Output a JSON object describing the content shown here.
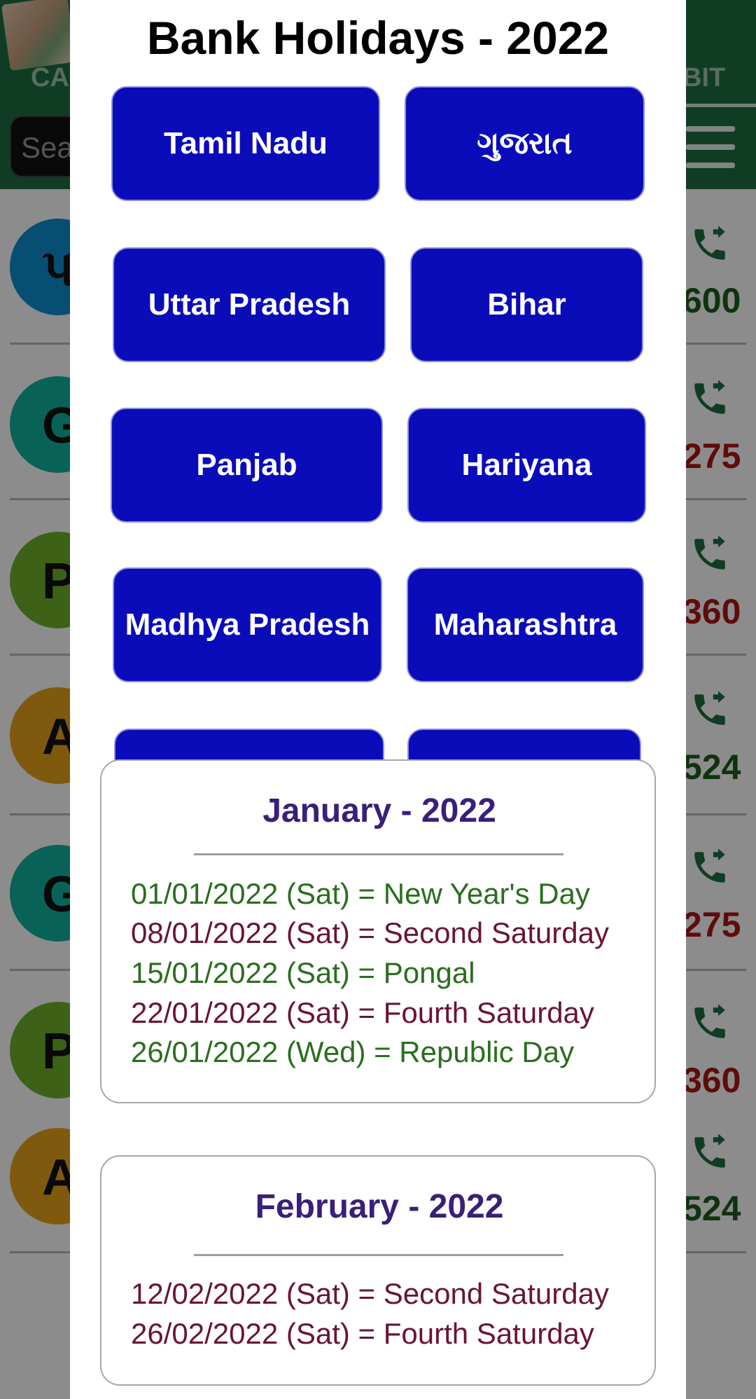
{
  "background": {
    "tab_left": "CA",
    "tab_right": "BIT",
    "search_placeholder": "Sea",
    "rows": [
      {
        "initial": "પ",
        "avatar_color": "#0c8fd0",
        "amount": "600",
        "amount_color": "#1c5e1c"
      },
      {
        "initial": "G",
        "avatar_color": "#11b3a0",
        "amount": "275",
        "amount_color": "#b01515"
      },
      {
        "initial": "P",
        "avatar_color": "#6fb32a",
        "amount": "360",
        "amount_color": "#b01515"
      },
      {
        "initial": "A",
        "avatar_color": "#e8a51b",
        "amount": "524",
        "amount_color": "#1c5e1c"
      },
      {
        "initial": "G",
        "avatar_color": "#11b3a0",
        "amount": "275",
        "amount_color": "#b01515"
      },
      {
        "initial": "P",
        "avatar_color": "#6fb32a",
        "amount": "360",
        "amount_color": "#b01515"
      },
      {
        "initial": "A",
        "avatar_color": "#e8a51b",
        "amount": "524",
        "amount_color": "#1c5e1c"
      }
    ]
  },
  "dialog": {
    "title": "Bank Holidays - 2022",
    "states": [
      "Tamil Nadu",
      "ગુજરાત",
      "Uttar Pradesh",
      "Bihar",
      "Panjab",
      "Hariyana",
      "Madhya Pradesh",
      "Maharashtra",
      "",
      ""
    ],
    "months": [
      {
        "title": "January - 2022",
        "holidays": [
          "01/01/2022 (Sat) = New Year's Day",
          "08/01/2022 (Sat) = Second Saturday",
          "15/01/2022 (Sat) = Pongal",
          "22/01/2022 (Sat) = Fourth Saturday",
          "26/01/2022 (Wed) = Republic Day"
        ]
      },
      {
        "title": "February - 2022",
        "holidays": [
          "12/02/2022 (Sat) = Second Saturday",
          "26/02/2022 (Sat) = Fourth Saturday"
        ]
      }
    ]
  },
  "colors": {
    "button_blue": "#0a0cba",
    "header_green": "#1f6e43",
    "holiday_green": "#2a6e1e",
    "holiday_maroon": "#6a1530",
    "month_title": "#3a1f7a"
  }
}
